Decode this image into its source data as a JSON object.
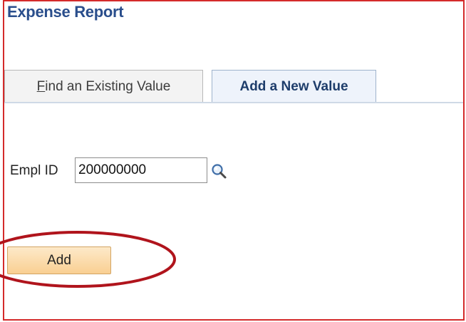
{
  "page": {
    "title": "Expense Report"
  },
  "tabs": [
    {
      "accel": "F",
      "label_rest": "ind an Existing Value",
      "active": false
    },
    {
      "label": "Add a New Value",
      "active": true
    }
  ],
  "form": {
    "empl_id_label": "Empl ID",
    "empl_id_value": "200000000",
    "lookup_icon": "magnifier-search-icon"
  },
  "actions": {
    "add_label": "Add"
  },
  "annotation": {
    "highlight_color": "#b0141c"
  },
  "colors": {
    "title": "#2a4e8c",
    "frame_border": "#d42a2a",
    "add_button": "#f9cf92"
  }
}
